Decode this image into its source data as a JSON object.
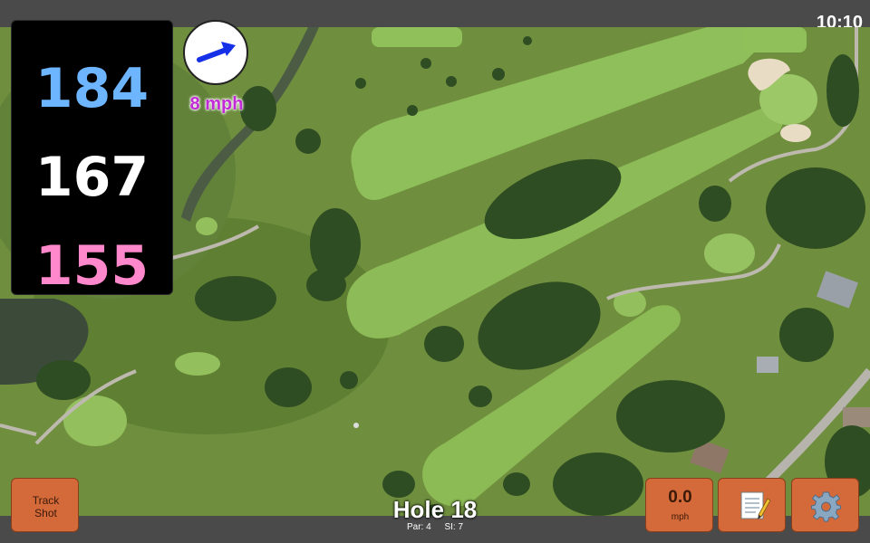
{
  "status_bar": {
    "time": "10:10"
  },
  "yardages": {
    "back": "184",
    "middle": "167",
    "front": "155",
    "back_color": "#6db6ff",
    "middle_color": "#ffffff",
    "front_color": "#ff88cc"
  },
  "wind": {
    "speed": "8 mph",
    "speed_color": "#c12ad6",
    "arrow_color": "#1530e6",
    "icon": "wind-direction-arrow-icon"
  },
  "hole": {
    "title": "Hole 18",
    "par": "Par: 4",
    "stroke_index": "SI: 7"
  },
  "buttons": {
    "track_shot_line1": "Track",
    "track_shot_line2": "Shot",
    "speed_value": "0.0",
    "speed_unit": "mph",
    "notes_icon": "notepad-icon",
    "settings_icon": "gear-icon",
    "button_color": "#d4693a"
  },
  "map": {
    "description_icon": "satellite-course-map"
  }
}
